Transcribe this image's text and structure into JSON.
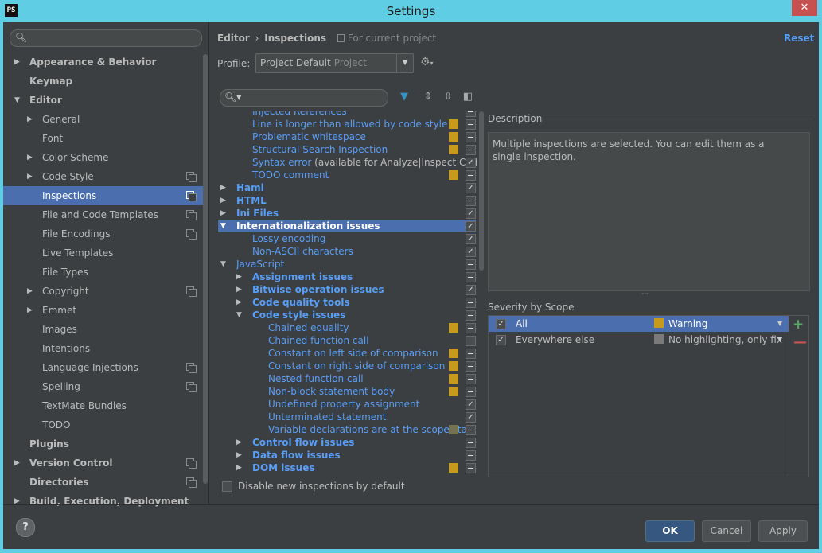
{
  "window": {
    "title": "Settings",
    "app_icon": "PS",
    "close_glyph": "✕"
  },
  "left_search": {
    "placeholder": ""
  },
  "left_tree": [
    {
      "label": "Appearance & Behavior",
      "level": 0,
      "arrow": "▶",
      "bold": true,
      "selected": false,
      "copy": false
    },
    {
      "label": "Keymap",
      "level": 0,
      "arrow": "",
      "bold": true,
      "selected": false,
      "copy": false
    },
    {
      "label": "Editor",
      "level": 0,
      "arrow": "▼",
      "bold": true,
      "selected": false,
      "copy": false
    },
    {
      "label": "General",
      "level": 1,
      "arrow": "▶",
      "bold": false,
      "selected": false,
      "copy": false
    },
    {
      "label": "Font",
      "level": 1,
      "arrow": "",
      "bold": false,
      "selected": false,
      "copy": false
    },
    {
      "label": "Color Scheme",
      "level": 1,
      "arrow": "▶",
      "bold": false,
      "selected": false,
      "copy": false
    },
    {
      "label": "Code Style",
      "level": 1,
      "arrow": "▶",
      "bold": false,
      "selected": false,
      "copy": true
    },
    {
      "label": "Inspections",
      "level": 1,
      "arrow": "",
      "bold": false,
      "selected": true,
      "copy": true
    },
    {
      "label": "File and Code Templates",
      "level": 1,
      "arrow": "",
      "bold": false,
      "selected": false,
      "copy": true
    },
    {
      "label": "File Encodings",
      "level": 1,
      "arrow": "",
      "bold": false,
      "selected": false,
      "copy": true
    },
    {
      "label": "Live Templates",
      "level": 1,
      "arrow": "",
      "bold": false,
      "selected": false,
      "copy": false
    },
    {
      "label": "File Types",
      "level": 1,
      "arrow": "",
      "bold": false,
      "selected": false,
      "copy": false
    },
    {
      "label": "Copyright",
      "level": 1,
      "arrow": "▶",
      "bold": false,
      "selected": false,
      "copy": true
    },
    {
      "label": "Emmet",
      "level": 1,
      "arrow": "▶",
      "bold": false,
      "selected": false,
      "copy": false
    },
    {
      "label": "Images",
      "level": 1,
      "arrow": "",
      "bold": false,
      "selected": false,
      "copy": false
    },
    {
      "label": "Intentions",
      "level": 1,
      "arrow": "",
      "bold": false,
      "selected": false,
      "copy": false
    },
    {
      "label": "Language Injections",
      "level": 1,
      "arrow": "",
      "bold": false,
      "selected": false,
      "copy": true
    },
    {
      "label": "Spelling",
      "level": 1,
      "arrow": "",
      "bold": false,
      "selected": false,
      "copy": true
    },
    {
      "label": "TextMate Bundles",
      "level": 1,
      "arrow": "",
      "bold": false,
      "selected": false,
      "copy": false
    },
    {
      "label": "TODO",
      "level": 1,
      "arrow": "",
      "bold": false,
      "selected": false,
      "copy": false
    },
    {
      "label": "Plugins",
      "level": 0,
      "arrow": "",
      "bold": true,
      "selected": false,
      "copy": false
    },
    {
      "label": "Version Control",
      "level": 0,
      "arrow": "▶",
      "bold": true,
      "selected": false,
      "copy": true
    },
    {
      "label": "Directories",
      "level": 0,
      "arrow": "",
      "bold": true,
      "selected": false,
      "copy": true
    },
    {
      "label": "Build, Execution, Deployment",
      "level": 0,
      "arrow": "▶",
      "bold": true,
      "selected": false,
      "copy": false
    }
  ],
  "header": {
    "crumb_editor": "Editor",
    "crumb_sep": "›",
    "crumb_inspections": "Inspections",
    "scope_note": "For current project",
    "reset": "Reset"
  },
  "profile": {
    "label": "Profile:",
    "value": "Project Default",
    "sub": "Project",
    "dropdown_icon": "▼",
    "gear_icon": "⚙"
  },
  "inspection_search": {
    "placeholder": ""
  },
  "toolbar_icons": [
    {
      "name": "filter-icon",
      "glyph": "▼",
      "color": "#3592c4"
    },
    {
      "name": "expand-all-icon",
      "glyph": "⇕",
      "color": "#aaaaaa"
    },
    {
      "name": "collapse-all-icon",
      "glyph": "⇳",
      "color": "#aaaaaa"
    },
    {
      "name": "reset-to-default-icon",
      "glyph": "◧",
      "color": "#aaaaaa"
    }
  ],
  "colors": {
    "warning": "#c79a1e",
    "none": "#7a7a7a",
    "weak_warning": "#757251",
    "accent": "#4b6eaf",
    "link": "#589df6"
  },
  "inspections": [
    {
      "label": "Injected References",
      "indent": 2,
      "tri": "",
      "bold": false,
      "plain": false,
      "sev": "",
      "check": "partial",
      "selected": false,
      "clipped": true
    },
    {
      "label": "Line is longer than allowed by code style",
      "indent": 2,
      "tri": "",
      "bold": false,
      "plain": false,
      "sev": "warning",
      "check": "partial",
      "selected": false
    },
    {
      "label": "Problematic whitespace",
      "indent": 2,
      "tri": "",
      "bold": false,
      "plain": false,
      "sev": "warning",
      "check": "partial",
      "selected": false
    },
    {
      "label": "Structural Search Inspection",
      "indent": 2,
      "tri": "",
      "bold": false,
      "plain": false,
      "sev": "warning",
      "check": "partial",
      "selected": false
    },
    {
      "label": "Syntax error",
      "suffix": " (available for Analyze|Inspect Cod",
      "indent": 2,
      "tri": "",
      "bold": false,
      "plain": false,
      "sev": "",
      "check": "checked",
      "selected": false
    },
    {
      "label": "TODO comment",
      "indent": 2,
      "tri": "",
      "bold": false,
      "plain": false,
      "sev": "warning",
      "check": "partial",
      "selected": false
    },
    {
      "label": "Haml",
      "indent": 1,
      "tri": "▶",
      "bold": true,
      "plain": false,
      "sev": "",
      "check": "checked",
      "selected": false
    },
    {
      "label": "HTML",
      "indent": 1,
      "tri": "▶",
      "bold": true,
      "plain": false,
      "sev": "",
      "check": "partial",
      "selected": false
    },
    {
      "label": "Ini Files",
      "indent": 1,
      "tri": "▶",
      "bold": true,
      "plain": false,
      "sev": "",
      "check": "checked",
      "selected": false
    },
    {
      "label": "Internationalization issues",
      "indent": 1,
      "tri": "▼",
      "bold": true,
      "plain": false,
      "sev": "",
      "check": "checked",
      "selected": true
    },
    {
      "label": "Lossy encoding",
      "indent": 2,
      "tri": "",
      "bold": false,
      "plain": false,
      "sev": "",
      "check": "checked",
      "selected": false
    },
    {
      "label": "Non-ASCII characters",
      "indent": 2,
      "tri": "",
      "bold": false,
      "plain": false,
      "sev": "",
      "check": "checked",
      "selected": false
    },
    {
      "label": "JavaScript",
      "indent": 1,
      "tri": "▼",
      "bold": false,
      "plain": false,
      "sev": "",
      "check": "partial",
      "selected": false
    },
    {
      "label": "Assignment issues",
      "indent": 2,
      "tri": "▶",
      "bold": true,
      "plain": false,
      "sev": "",
      "check": "partial",
      "selected": false
    },
    {
      "label": "Bitwise operation issues",
      "indent": 2,
      "tri": "▶",
      "bold": true,
      "plain": false,
      "sev": "",
      "check": "checked",
      "selected": false
    },
    {
      "label": "Code quality tools",
      "indent": 2,
      "tri": "▶",
      "bold": true,
      "plain": false,
      "sev": "",
      "check": "partial",
      "selected": false
    },
    {
      "label": "Code style issues",
      "indent": 2,
      "tri": "▼",
      "bold": true,
      "plain": false,
      "sev": "",
      "check": "partial",
      "selected": false
    },
    {
      "label": "Chained equality",
      "indent": 3,
      "tri": "",
      "bold": false,
      "plain": false,
      "sev": "warning",
      "check": "partial",
      "selected": false
    },
    {
      "label": "Chained function call",
      "indent": 3,
      "tri": "",
      "bold": false,
      "plain": false,
      "sev": "",
      "check": "empty",
      "selected": false
    },
    {
      "label": "Constant on left side of comparison",
      "indent": 3,
      "tri": "",
      "bold": false,
      "plain": false,
      "sev": "warning",
      "check": "partial",
      "selected": false
    },
    {
      "label": "Constant on right side of comparison",
      "indent": 3,
      "tri": "",
      "bold": false,
      "plain": false,
      "sev": "warning",
      "check": "partial",
      "selected": false
    },
    {
      "label": "Nested function call",
      "indent": 3,
      "tri": "",
      "bold": false,
      "plain": false,
      "sev": "warning",
      "check": "partial",
      "selected": false
    },
    {
      "label": "Non-block statement body",
      "indent": 3,
      "tri": "",
      "bold": false,
      "plain": false,
      "sev": "warning",
      "check": "partial",
      "selected": false
    },
    {
      "label": "Undefined property assignment",
      "indent": 3,
      "tri": "",
      "bold": false,
      "plain": false,
      "sev": "",
      "check": "checked",
      "selected": false
    },
    {
      "label": "Unterminated statement",
      "indent": 3,
      "tri": "",
      "bold": false,
      "plain": false,
      "sev": "",
      "check": "checked",
      "selected": false
    },
    {
      "label": "Variable declarations are at the scope start",
      "indent": 3,
      "tri": "",
      "bold": false,
      "plain": false,
      "sev": "weak",
      "check": "partial",
      "selected": false
    },
    {
      "label": "Control flow issues",
      "indent": 2,
      "tri": "▶",
      "bold": true,
      "plain": false,
      "sev": "",
      "check": "partial",
      "selected": false
    },
    {
      "label": "Data flow issues",
      "indent": 2,
      "tri": "▶",
      "bold": true,
      "plain": false,
      "sev": "",
      "check": "partial",
      "selected": false
    },
    {
      "label": "DOM issues",
      "indent": 2,
      "tri": "▶",
      "bold": true,
      "plain": false,
      "sev": "warning",
      "check": "partial",
      "selected": false
    }
  ],
  "disable_new": {
    "label": "Disable new inspections by default",
    "checked": false
  },
  "description": {
    "title": "Description",
    "text": "Multiple inspections are selected. You can edit them as a single inspection."
  },
  "severity_by_scope": {
    "title": "Severity by Scope",
    "rows": [
      {
        "scope": "All",
        "level": "Warning",
        "color": "warning",
        "checked": true,
        "selected": true
      },
      {
        "scope": "Everywhere else",
        "level": "No highlighting, only fix",
        "color": "none",
        "checked": true,
        "selected": false
      }
    ],
    "add_glyph": "+",
    "remove_glyph": "—"
  },
  "buttons": {
    "help": "?",
    "ok": "OK",
    "cancel": "Cancel",
    "apply": "Apply"
  }
}
